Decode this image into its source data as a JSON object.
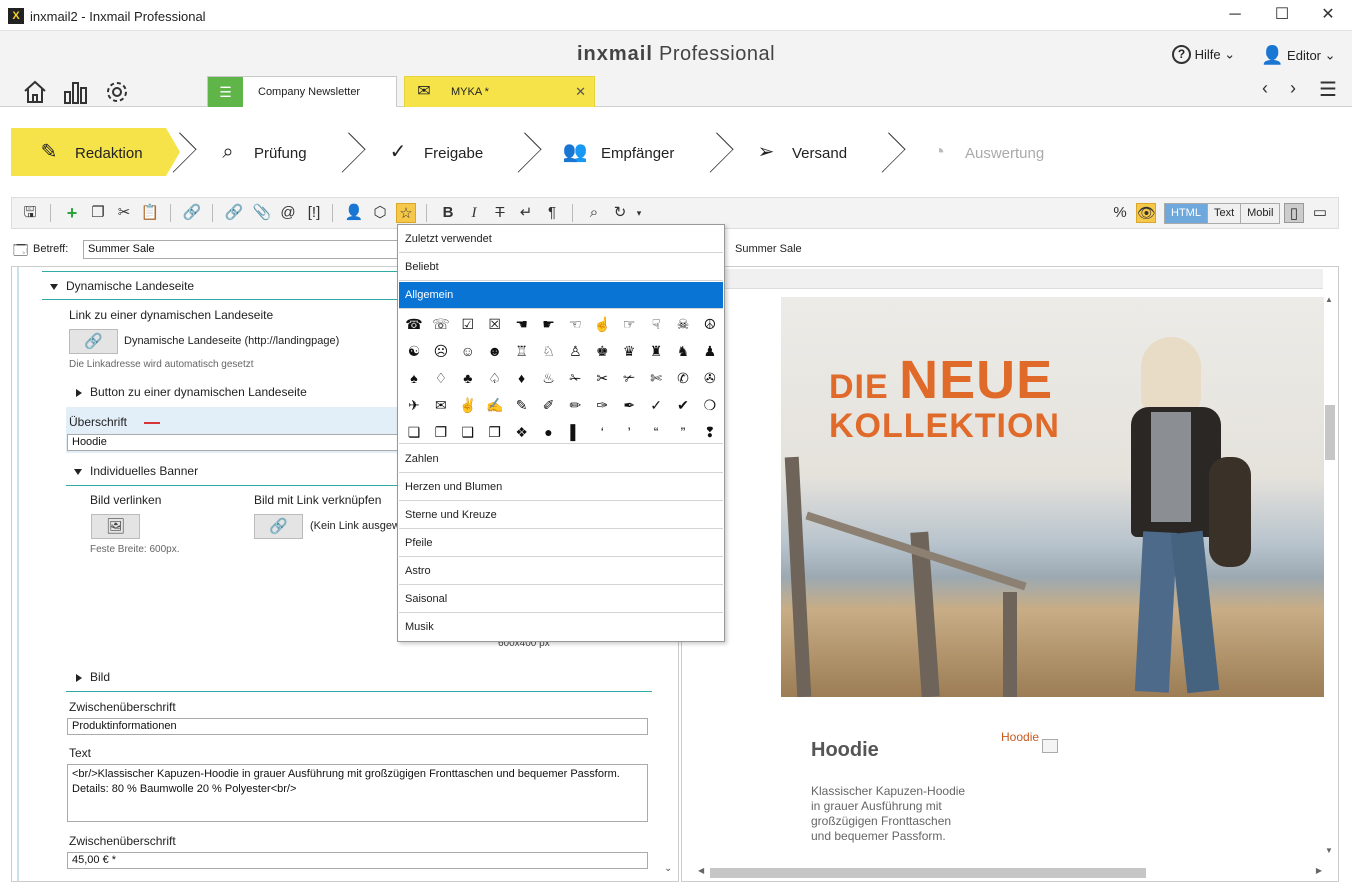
{
  "window": {
    "title": "inxmail2 - Inxmail Professional",
    "app_icon": "inxmail-logo-icon",
    "controls": [
      "minimize-icon",
      "maximize-icon",
      "close-icon"
    ]
  },
  "header": {
    "brand_bold": "inxmail",
    "brand_rest": " Professional",
    "help_label": "Hilfe",
    "user_label": "Editor",
    "tabs": [
      {
        "label": "Company Newsletter",
        "icon": "list-icon"
      },
      {
        "label": "MYKA *",
        "icon": "envelope-icon"
      }
    ]
  },
  "steps": [
    {
      "label": "Redaktion",
      "icon": "pencil-icon",
      "active": true
    },
    {
      "label": "Prüfung",
      "icon": "magnifier-icon"
    },
    {
      "label": "Freigabe",
      "icon": "checkmark-icon"
    },
    {
      "label": "Empfänger",
      "icon": "users-icon"
    },
    {
      "label": "Versand",
      "icon": "paper-plane-icon"
    },
    {
      "label": "Auswertung",
      "icon": "pie-chart-icon",
      "disabled": true
    }
  ],
  "toolbar": {
    "view_modes": [
      "HTML",
      "Text",
      "Mobil"
    ],
    "active_view": "HTML"
  },
  "subject": {
    "label": "Betreff:",
    "value": "Summer Sale",
    "preview_value": "Summer Sale"
  },
  "editor": {
    "section_landing": "Dynamische Landeseite",
    "link_landing_label": "Link zu einer dynamischen Landeseite",
    "link_landing_value": "Dynamische Landeseite (http://landingpage)",
    "link_landing_hint": "Die Linkadresse wird automatisch gesetzt",
    "button_landing": "Button zu einer dynamischen Landeseite",
    "heading_label": "Überschrift",
    "heading_value": "Hoodie",
    "banner_section": "Individuelles Banner",
    "image_link_label": "Bild verlinken",
    "image_with_link_label": "Bild mit Link verknüpfen",
    "no_link_text": "(Kein Link ausgew",
    "fixed_width": "Feste Breite: 600px.",
    "image_size": "600x400 px",
    "image_section": "Bild",
    "subheading1_label": "Zwischenüberschrift",
    "subheading1_value": "Produktinformationen",
    "text_label": "Text",
    "text_value_line1": "<br/>Klassischer Kapuzen-Hoodie in grauer Ausführung mit großzügigen Fronttaschen und bequemer Passform.",
    "text_value_line2": "Details: 80 % Baumwolle 20 % Polyester<br/>",
    "subheading2_label": "Zwischenüberschrift",
    "subheading2_value": "45,00 € *"
  },
  "preview": {
    "hero_line1_small": "DIE ",
    "hero_line1_big": "NEUE",
    "hero_line2": "KOLLEKTION",
    "product_title": "Hoodie",
    "product_link": "Hoodie",
    "product_desc_1": "Klassischer Kapuzen-Hoodie",
    "product_desc_2": "in grauer Ausführung mit",
    "product_desc_3": "großzügigen Fronttaschen",
    "product_desc_4": "und bequemer Passform."
  },
  "symbol_menu": {
    "top_items": [
      "Zuletzt verwendet",
      "Beliebt",
      "Allgemein"
    ],
    "selected": "Allgemein",
    "symbols": [
      [
        "☎",
        "☏",
        "☑",
        "☒",
        "☚",
        "☛",
        "☜",
        "☝",
        "☞",
        "☟",
        "☠",
        "☮"
      ],
      [
        "☯",
        "☹",
        "☺",
        "☻",
        "♖",
        "♘",
        "♙",
        "♚",
        "♛",
        "♜",
        "♞",
        "♟"
      ],
      [
        "♠",
        "♢",
        "♣",
        "♤",
        "♦",
        "♨",
        "✁",
        "✂",
        "✃",
        "✄",
        "✆",
        "✇"
      ],
      [
        "✈",
        "✉",
        "✌",
        "✍",
        "✎",
        "✐",
        "✏",
        "✑",
        "✒",
        "✓",
        "✔",
        "❍"
      ],
      [
        "❏",
        "❐",
        "❑",
        "❒",
        "❖",
        "●",
        "▌",
        "‘",
        "’",
        "“",
        "”",
        "❢"
      ]
    ],
    "bottom_items": [
      "Zahlen",
      "Herzen und Blumen",
      "Sterne und Kreuze",
      "Pfeile",
      "Astro",
      "Saisonal",
      "Musik"
    ]
  },
  "colors": {
    "accent_yellow": "#f6e34a",
    "accent_green": "#5fb548",
    "selection_blue": "#0a74d4",
    "hero_orange": "#e06a2a",
    "teal_line": "#31a9a5"
  }
}
